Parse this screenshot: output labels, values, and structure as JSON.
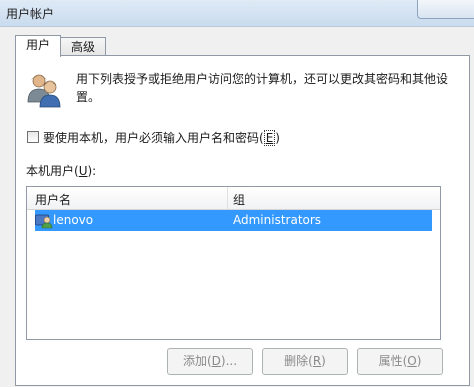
{
  "window": {
    "title": "用户帐户"
  },
  "tabs": [
    {
      "label": "用户",
      "active": true
    },
    {
      "label": "高级",
      "active": false
    }
  ],
  "description": "用下列表授予或拒绝用户访问您的计算机，还可以更改其密码和其他设置。",
  "require_password": {
    "checked": false,
    "label_prefix": "要使用本机，用户必须输入用户名和密码(",
    "hotkey": "E",
    "label_suffix": ")"
  },
  "local_users": {
    "label_prefix": "本机用户(",
    "hotkey": "U",
    "label_suffix": "):",
    "columns": [
      "用户名",
      "组"
    ],
    "rows": [
      {
        "name": "lenovo",
        "group": "Administrators",
        "selected": true
      }
    ]
  },
  "buttons": [
    {
      "prefix": "添加(",
      "hotkey": "D",
      "suffix": ")...",
      "enabled": false
    },
    {
      "prefix": "删除(",
      "hotkey": "R",
      "suffix": ")",
      "enabled": false
    },
    {
      "prefix": "属性(",
      "hotkey": "O",
      "suffix": ")",
      "enabled": false
    }
  ],
  "colors": {
    "selection": "#3399ff",
    "disabled_text": "#8a8a8a"
  },
  "icons": [
    "users-icon",
    "user-row-icon"
  ]
}
